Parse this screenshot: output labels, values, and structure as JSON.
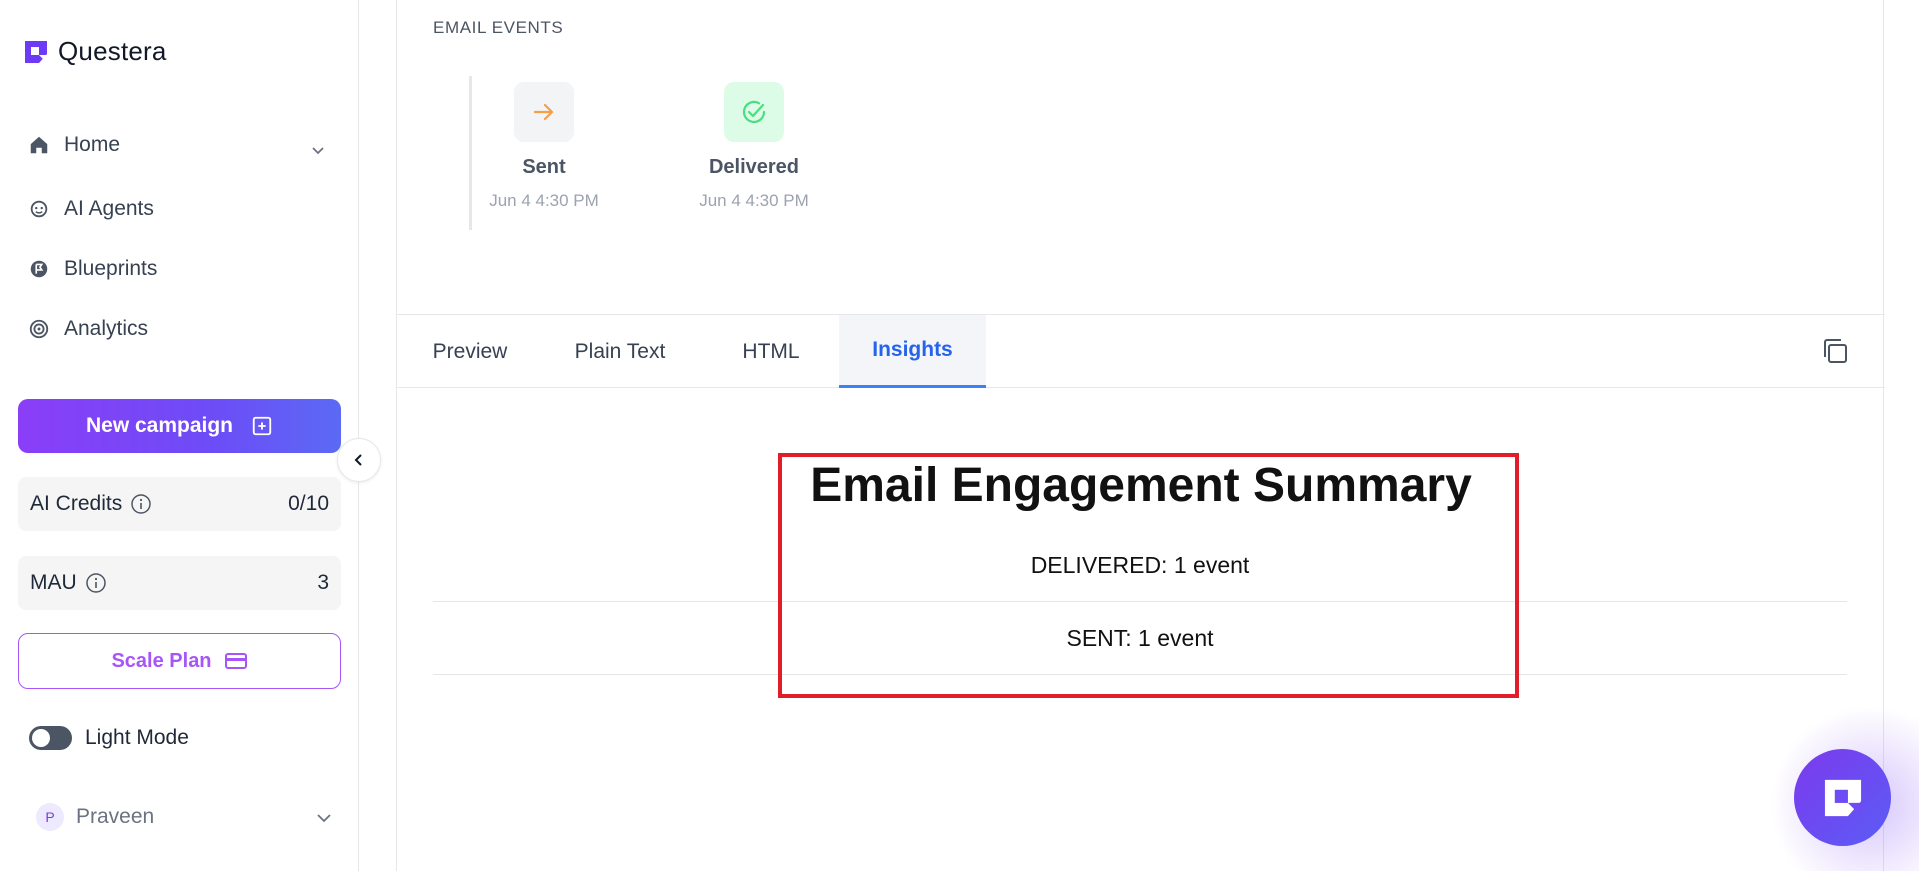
{
  "brand": {
    "name": "Questera"
  },
  "nav": {
    "items": [
      {
        "label": "Home",
        "icon": "home-icon"
      },
      {
        "label": "AI Agents",
        "icon": "agent-icon"
      },
      {
        "label": "Blueprints",
        "icon": "blueprint-icon"
      },
      {
        "label": "Analytics",
        "icon": "analytics-icon"
      }
    ]
  },
  "sidebar": {
    "new_campaign_label": "New campaign",
    "ai_credits": {
      "label": "AI Credits",
      "value": "0/10"
    },
    "mau": {
      "label": "MAU",
      "value": "3"
    },
    "scale_plan_label": "Scale Plan",
    "light_mode_label": "Light Mode",
    "light_mode_on": false,
    "user": {
      "initial": "P",
      "name": "Praveen"
    }
  },
  "email_events": {
    "title": "EMAIL EVENTS",
    "events": [
      {
        "title": "Sent",
        "time": "Jun 4 4:30 PM",
        "icon": "arrow-right-icon",
        "color": "#f59e4c"
      },
      {
        "title": "Delivered",
        "time": "Jun 4 4:30 PM",
        "icon": "check-circle-icon",
        "color": "#4ade80"
      }
    ]
  },
  "tabs": {
    "items": [
      {
        "label": "Preview"
      },
      {
        "label": "Plain Text"
      },
      {
        "label": "HTML"
      },
      {
        "label": "Insights"
      }
    ],
    "active": "Insights"
  },
  "insights": {
    "title": "Email Engagement Summary",
    "rows": [
      "DELIVERED: 1 event",
      "SENT: 1 event"
    ]
  },
  "colors": {
    "accent": "#2563eb",
    "brand_purple": "#7c3aed",
    "highlight": "#e11d2a"
  }
}
